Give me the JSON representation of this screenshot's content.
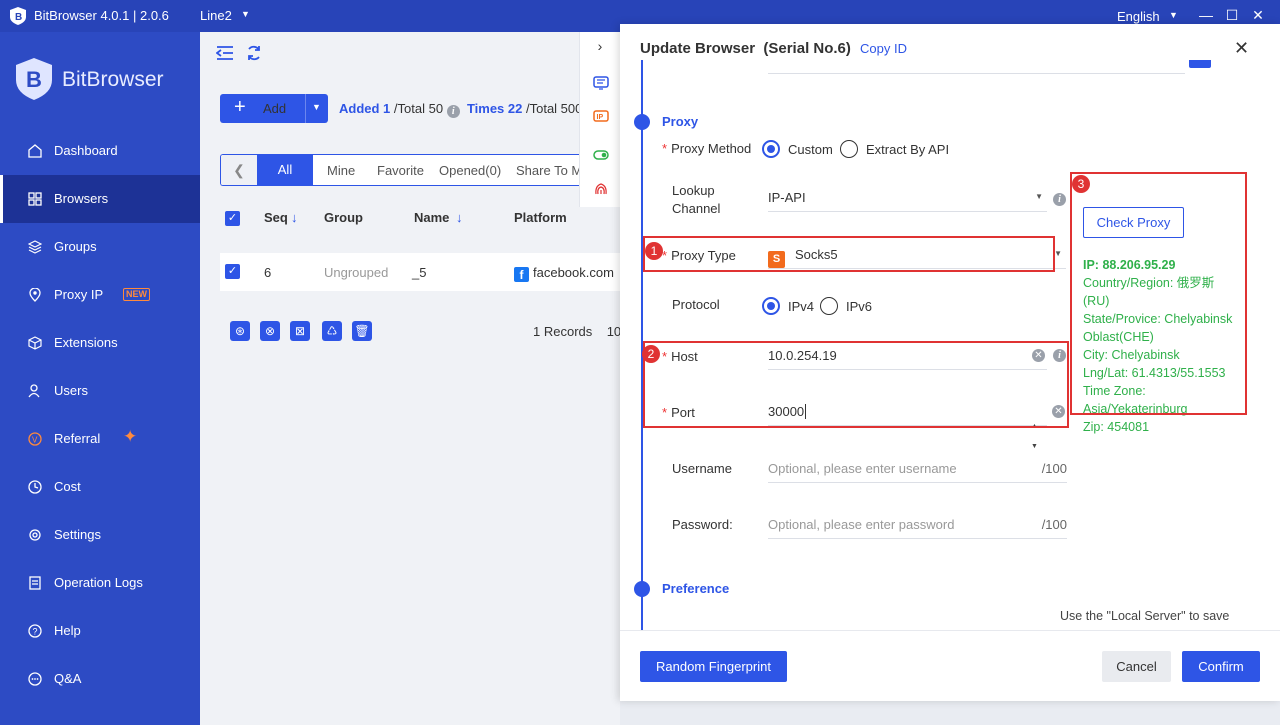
{
  "titlebar": {
    "app_title": "BitBrowser 4.0.1 | 2.0.6",
    "line": "Line2",
    "language": "English"
  },
  "sidebar": {
    "brand": "BitBrowser",
    "items": [
      {
        "label": "Dashboard",
        "icon": "home-icon"
      },
      {
        "label": "Browsers",
        "icon": "grid-icon",
        "active": true
      },
      {
        "label": "Groups",
        "icon": "layers-icon"
      },
      {
        "label": "Proxy IP",
        "icon": "location-pin-icon",
        "badge": "NEW"
      },
      {
        "label": "Extensions",
        "icon": "cube-icon"
      },
      {
        "label": "Users",
        "icon": "user-icon"
      },
      {
        "label": "Referral",
        "icon": "referral-icon"
      },
      {
        "label": "Cost",
        "icon": "clock-icon"
      },
      {
        "label": "Settings",
        "icon": "gear-icon"
      },
      {
        "label": "Operation Logs",
        "icon": "log-icon"
      },
      {
        "label": "Help",
        "icon": "help-icon"
      },
      {
        "label": "Q&A",
        "icon": "chat-icon"
      }
    ]
  },
  "main": {
    "add_label": "Add",
    "stats": {
      "added_label": "Added 1",
      "total_profiles": "/Total 50",
      "times_label": "Times 22",
      "total_times": "/Total 500"
    },
    "tabs": [
      "All",
      "Mine",
      "Favorite",
      "Opened(0)",
      "Share To M"
    ],
    "columns": {
      "seq": "Seq",
      "group": "Group",
      "name": "Name",
      "platform": "Platform"
    },
    "row": {
      "seq": "6",
      "group": "Ungrouped",
      "name": "_5",
      "platform": "facebook.com"
    },
    "records": "1 Records",
    "page_size": "10"
  },
  "dialog": {
    "title": "Update Browser",
    "serial": "(Serial No.6)",
    "copy_id": "Copy ID",
    "proxy_section": "Proxy",
    "proxy_method_label": "Proxy Method",
    "proxy_method_options": [
      "Custom",
      "Extract By API"
    ],
    "lookup_label_1": "Lookup",
    "lookup_label_2": "Channel",
    "lookup_value": "IP-API",
    "proxy_type_label": "Proxy Type",
    "proxy_type_value": "Socks5",
    "protocol_label": "Protocol",
    "protocol_options": [
      "IPv4",
      "IPv6"
    ],
    "host_label": "Host",
    "host_value": "10.0.254.19",
    "port_label": "Port",
    "port_value": "30000",
    "username_label": "Username",
    "username_placeholder": "Optional, please enter username",
    "username_count": "/100",
    "password_label": "Password:",
    "password_placeholder": "Optional, please enter password",
    "password_count": "/100",
    "check_proxy": "Check Proxy",
    "ip_info": {
      "ip": "IP:  88.206.95.29",
      "country_1": "Country/Region: 俄罗斯",
      "country_2": "(RU)",
      "state_1": "State/Provice: Chelyabinsk",
      "state_2": "Oblast(CHE)",
      "city": "City: Chelyabinsk",
      "lnglat": "Lng/Lat: 61.4313/55.1553",
      "tz_1": "Time Zone:",
      "tz_2": "Asia/Yekaterinburg",
      "zip": "Zip: 454081"
    },
    "preference_section": "Preference",
    "preference_note": "Use the \"Local Server\" to save",
    "annotation_badges": [
      "1",
      "2",
      "3"
    ],
    "random_fingerprint": "Random Fingerprint",
    "cancel": "Cancel",
    "confirm": "Confirm"
  },
  "colors": {
    "primary": "#2e55e6",
    "sidebar": "#2d4bc4",
    "titlebar": "#2844b8",
    "annotation_red": "#e03333",
    "ip_green": "#2fb04a",
    "accent_orange": "#ff8a3d"
  }
}
